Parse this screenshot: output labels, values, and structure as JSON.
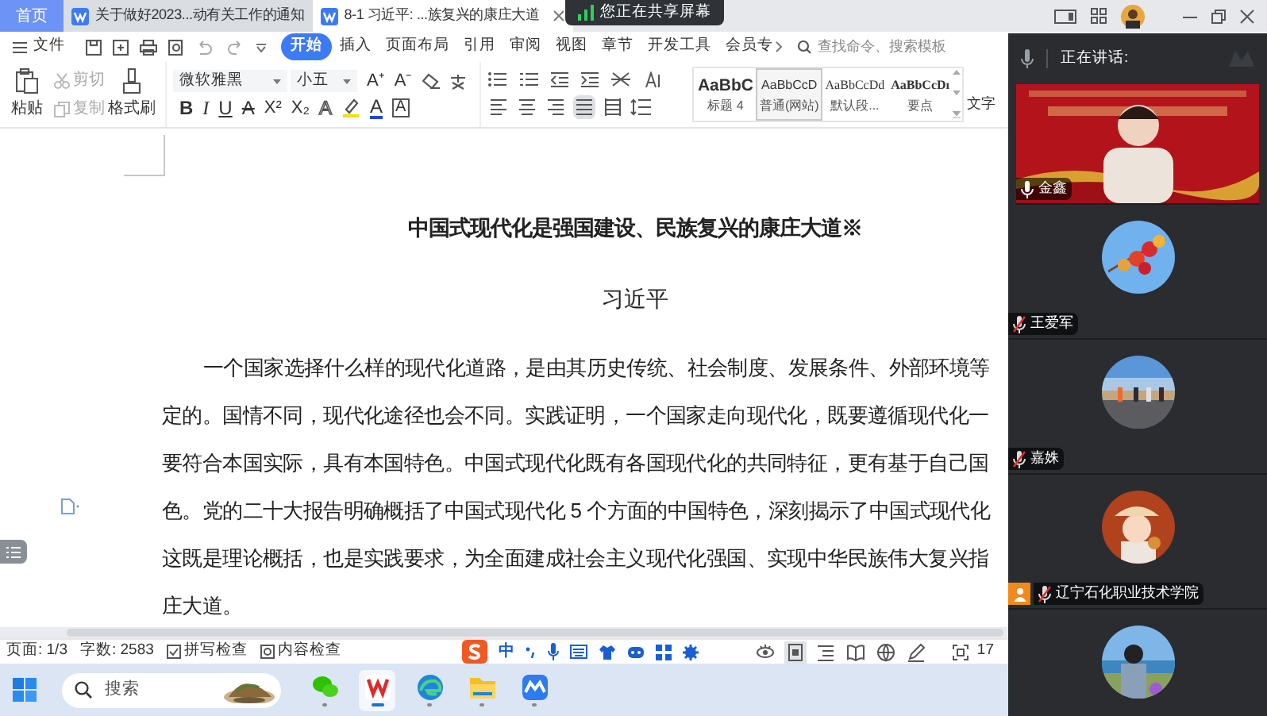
{
  "tabs": [
    {
      "label": "首页",
      "kind": "home",
      "selected": false
    },
    {
      "label": "关于做好2023...动有关工作的通知",
      "kind": "doc",
      "selected": false
    },
    {
      "label": "8-1 习近平: ...族复兴的康庄大道",
      "kind": "doc",
      "selected": true
    }
  ],
  "share_banner": "您正在共享屏幕",
  "menu": {
    "file": "文件",
    "items": [
      {
        "label": "开始",
        "selected": true
      },
      {
        "label": "插入",
        "selected": false
      },
      {
        "label": "页面布局",
        "selected": false
      },
      {
        "label": "引用",
        "selected": false
      },
      {
        "label": "审阅",
        "selected": false
      },
      {
        "label": "视图",
        "selected": false
      },
      {
        "label": "章节",
        "selected": false
      },
      {
        "label": "开发工具",
        "selected": false
      },
      {
        "label": "会员专",
        "selected": false
      }
    ],
    "search_placeholder": "查找命令、搜索模板"
  },
  "ribbon": {
    "paste": "粘贴",
    "cut": {
      "label": "剪切",
      "disabled": true
    },
    "copy": {
      "label": "复制",
      "disabled": true
    },
    "format_painter": "格式刷",
    "font": "微软雅黑",
    "size": "小五",
    "size_buttons": [
      "A⁺",
      "A⁻"
    ],
    "format_buttons": [
      {
        "label": "B",
        "kind": "bold"
      },
      {
        "label": "I",
        "kind": "italic"
      },
      {
        "label": "U",
        "kind": "underline"
      },
      {
        "label": "A",
        "kind": "strike"
      },
      {
        "label": "X²",
        "kind": "sup"
      },
      {
        "label": "X₂",
        "kind": "sub"
      },
      {
        "label": "A",
        "kind": "effect"
      },
      {
        "label": "A",
        "kind": "color"
      },
      {
        "label": "A",
        "kind": "border"
      }
    ],
    "alignment": [
      {
        "kind": "left",
        "selected": false
      },
      {
        "kind": "center",
        "selected": false
      },
      {
        "kind": "right",
        "selected": false
      },
      {
        "kind": "justify",
        "selected": true
      },
      {
        "kind": "distributed",
        "selected": false
      }
    ],
    "styles": [
      {
        "sample": "AaBbC",
        "name": "标题 4",
        "kind": "heading",
        "selected": false
      },
      {
        "sample": "AaBbCcD",
        "name": "普通(网站)",
        "kind": "normal",
        "selected": true
      },
      {
        "sample": "AaBbCcDd",
        "name": "默认段...",
        "kind": "serif",
        "selected": false
      },
      {
        "sample": "AaBbCcDı",
        "name": "要点",
        "kind": "strong",
        "selected": false
      }
    ],
    "text_tool": "文字"
  },
  "document": {
    "title": "中国式现代化是强国建设、民族复兴的康庄大道※",
    "author": "习近平",
    "lines": [
      "一个国家选择什么样的现代化道路，是由其历史传统、社会制度、发展条件、外部环境等",
      "定的。国情不同，现代化途径也会不同。实践证明，一个国家走向现代化，既要遵循现代化一",
      "要符合本国实际，具有本国特色。中国式现代化既有各国现代化的共同特征，更有基于自己国",
      "色。党的二十大报告明确概括了中国式现代化 5 个方面的中国特色，深刻揭示了中国式现代化",
      "这既是理论概括，也是实践要求，为全面建成社会主义现代化强国、实现中华民族伟大复兴指",
      "庄大道。"
    ]
  },
  "status_bar": {
    "page": "页面: 1/3",
    "words": "字数: 2583",
    "spell_check": "拼写检查",
    "content_check": "内容检查",
    "ime_mode": "中",
    "views": [
      {
        "kind": "read",
        "selected": false
      },
      {
        "kind": "page",
        "selected": true
      },
      {
        "kind": "outline",
        "selected": false
      },
      {
        "kind": "book",
        "selected": false
      },
      {
        "kind": "web",
        "selected": false
      },
      {
        "kind": "write",
        "selected": false
      }
    ],
    "zoom": "17"
  },
  "taskbar": {
    "search_placeholder": "搜索",
    "apps": [
      {
        "kind": "chat",
        "selected": false
      },
      {
        "kind": "wps",
        "selected": true
      },
      {
        "kind": "browser",
        "selected": false
      },
      {
        "kind": "folder",
        "selected": false
      },
      {
        "kind": "meeting",
        "selected": false
      }
    ]
  },
  "meeting": {
    "header": "正在讲话:",
    "participants": [
      {
        "name": "金鑫",
        "kind": "video",
        "muted": false,
        "host": false
      },
      {
        "name": "王爱军",
        "kind": "avatar",
        "muted": true,
        "host": false
      },
      {
        "name": "嘉姝",
        "kind": "avatar",
        "muted": true,
        "host": false
      },
      {
        "name": "辽宁石化职业技术学院",
        "kind": "avatar",
        "muted": true,
        "host": true
      },
      {
        "kind": "avatar"
      }
    ]
  }
}
